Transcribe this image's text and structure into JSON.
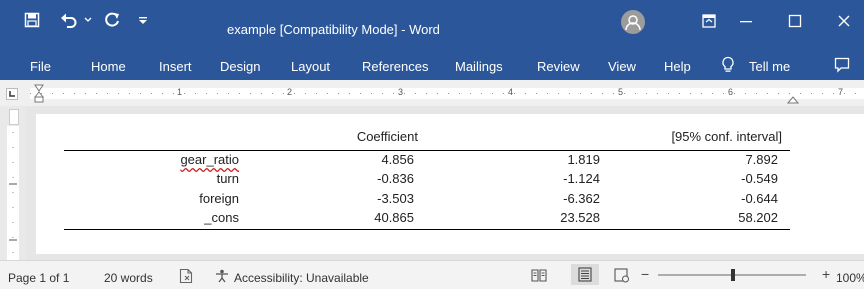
{
  "window": {
    "title": "example [Compatibility Mode]  -  Word",
    "qat": {
      "save_icon": "save-icon",
      "undo_icon": "undo-icon",
      "redo_icon": "redo-icon",
      "customize_icon": "customize-qat-icon"
    },
    "controls": {
      "ribbon_display_icon": "ribbon-display-icon",
      "minimize_icon": "minimize-icon",
      "maximize_icon": "maximize-icon",
      "close_icon": "close-icon"
    }
  },
  "menu": {
    "file": "File",
    "home": "Home",
    "insert": "Insert",
    "design": "Design",
    "layout": "Layout",
    "references": "References",
    "mailings": "Mailings",
    "review": "Review",
    "view": "View",
    "help": "Help",
    "tell_me": "Tell me"
  },
  "ruler": {
    "numbers": [
      "1",
      "2",
      "3",
      "4",
      "5",
      "6",
      "7"
    ]
  },
  "table": {
    "headers": {
      "coef": "Coefficient",
      "ci": "[95% conf. interval]"
    },
    "rows": [
      {
        "var": "gear_ratio",
        "coef": "4.856",
        "lower": "1.819",
        "upper": "7.892"
      },
      {
        "var": "turn",
        "coef": "-0.836",
        "lower": "-1.124",
        "upper": "-0.549"
      },
      {
        "var": "foreign",
        "coef": "-3.503",
        "lower": "-6.362",
        "upper": "-0.644"
      },
      {
        "var": "_cons",
        "coef": "40.865",
        "lower": "23.528",
        "upper": "58.202"
      }
    ]
  },
  "status": {
    "page": "Page 1 of 1",
    "words": "20 words",
    "accessibility": "Accessibility: Unavailable",
    "zoom": "100%"
  },
  "colors": {
    "title_bar": "#2b579a",
    "status_bar": "#f3f3f3"
  }
}
